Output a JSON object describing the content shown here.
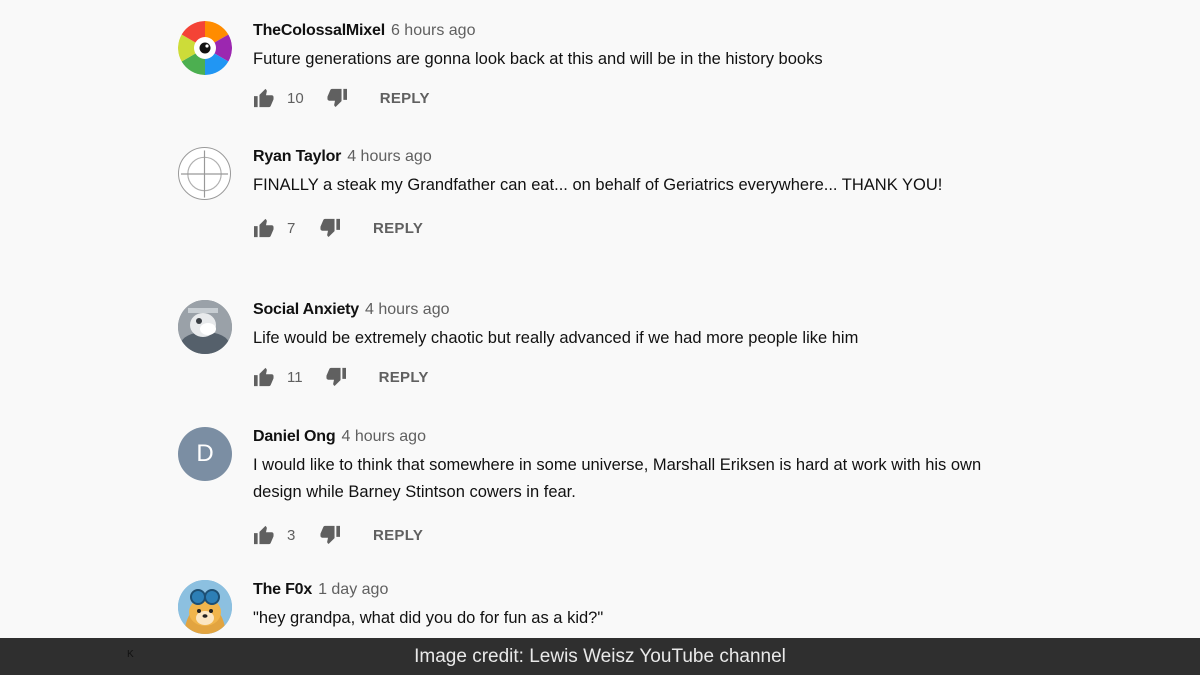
{
  "comments": [
    {
      "author": "TheColossalMixel",
      "time": "6 hours ago",
      "text": "Future generations are gonna look back at this and will be in the history books",
      "likes": "10",
      "reply_label": "REPLY",
      "avatar": "color-wheel-eye"
    },
    {
      "author": "Ryan Taylor",
      "time": "4 hours ago",
      "text": "FINALLY a steak my Grandfather can eat... on behalf of Geriatrics everywhere... THANK YOU!",
      "likes": "7",
      "reply_label": "REPLY",
      "avatar": "crosshair"
    },
    {
      "author": "Social Anxiety",
      "time": "4 hours ago",
      "text": "Life would be extremely chaotic but really advanced if we had more people like him",
      "likes": "11",
      "reply_label": "REPLY",
      "avatar": "photo"
    },
    {
      "author": "Daniel Ong",
      "time": "4 hours ago",
      "text": "I would like to think that somewhere in some universe, Marshall Eriksen is hard at work with his own design while Barney Stintson cowers in fear.",
      "likes": "3",
      "reply_label": "REPLY",
      "avatar_initial": "D"
    },
    {
      "author": "The F0x",
      "time": "1 day ago",
      "text": "\"hey grandpa, what did you do for fun as a kid?\"",
      "avatar": "fox-cartoon"
    }
  ],
  "credit": "Image credit: Lewis Weisz YouTube channel",
  "credit_mark": "K"
}
